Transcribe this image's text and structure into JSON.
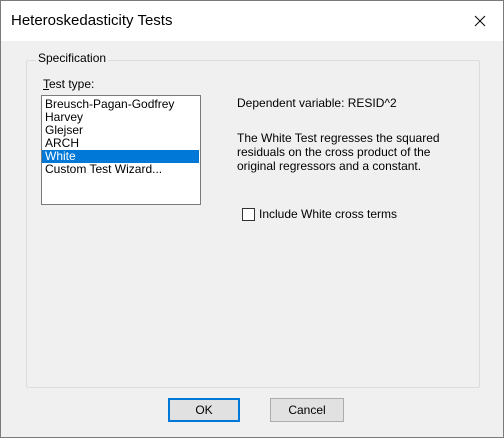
{
  "window": {
    "title": "Heteroskedasticity Tests",
    "close_glyph": "close-icon"
  },
  "specification": {
    "group_label": "Specification",
    "test_type_label": "Test type:",
    "test_types": [
      "Breusch-Pagan-Godfrey",
      "Harvey",
      "Glejser",
      "ARCH",
      "White",
      "Custom Test Wizard..."
    ],
    "selected_test": "White",
    "dependent_variable": "Dependent variable: RESID^2",
    "description_lines": [
      "The White Test regresses the squared",
      "residuals on the cross product of the",
      "original regressors and a constant."
    ],
    "cross_terms_label": "Include White cross terms",
    "cross_terms_checked": false
  },
  "buttons": {
    "ok": "OK",
    "cancel": "Cancel"
  },
  "colors": {
    "selection": "#0078d7",
    "dialog_bg": "#f0f0f0"
  }
}
